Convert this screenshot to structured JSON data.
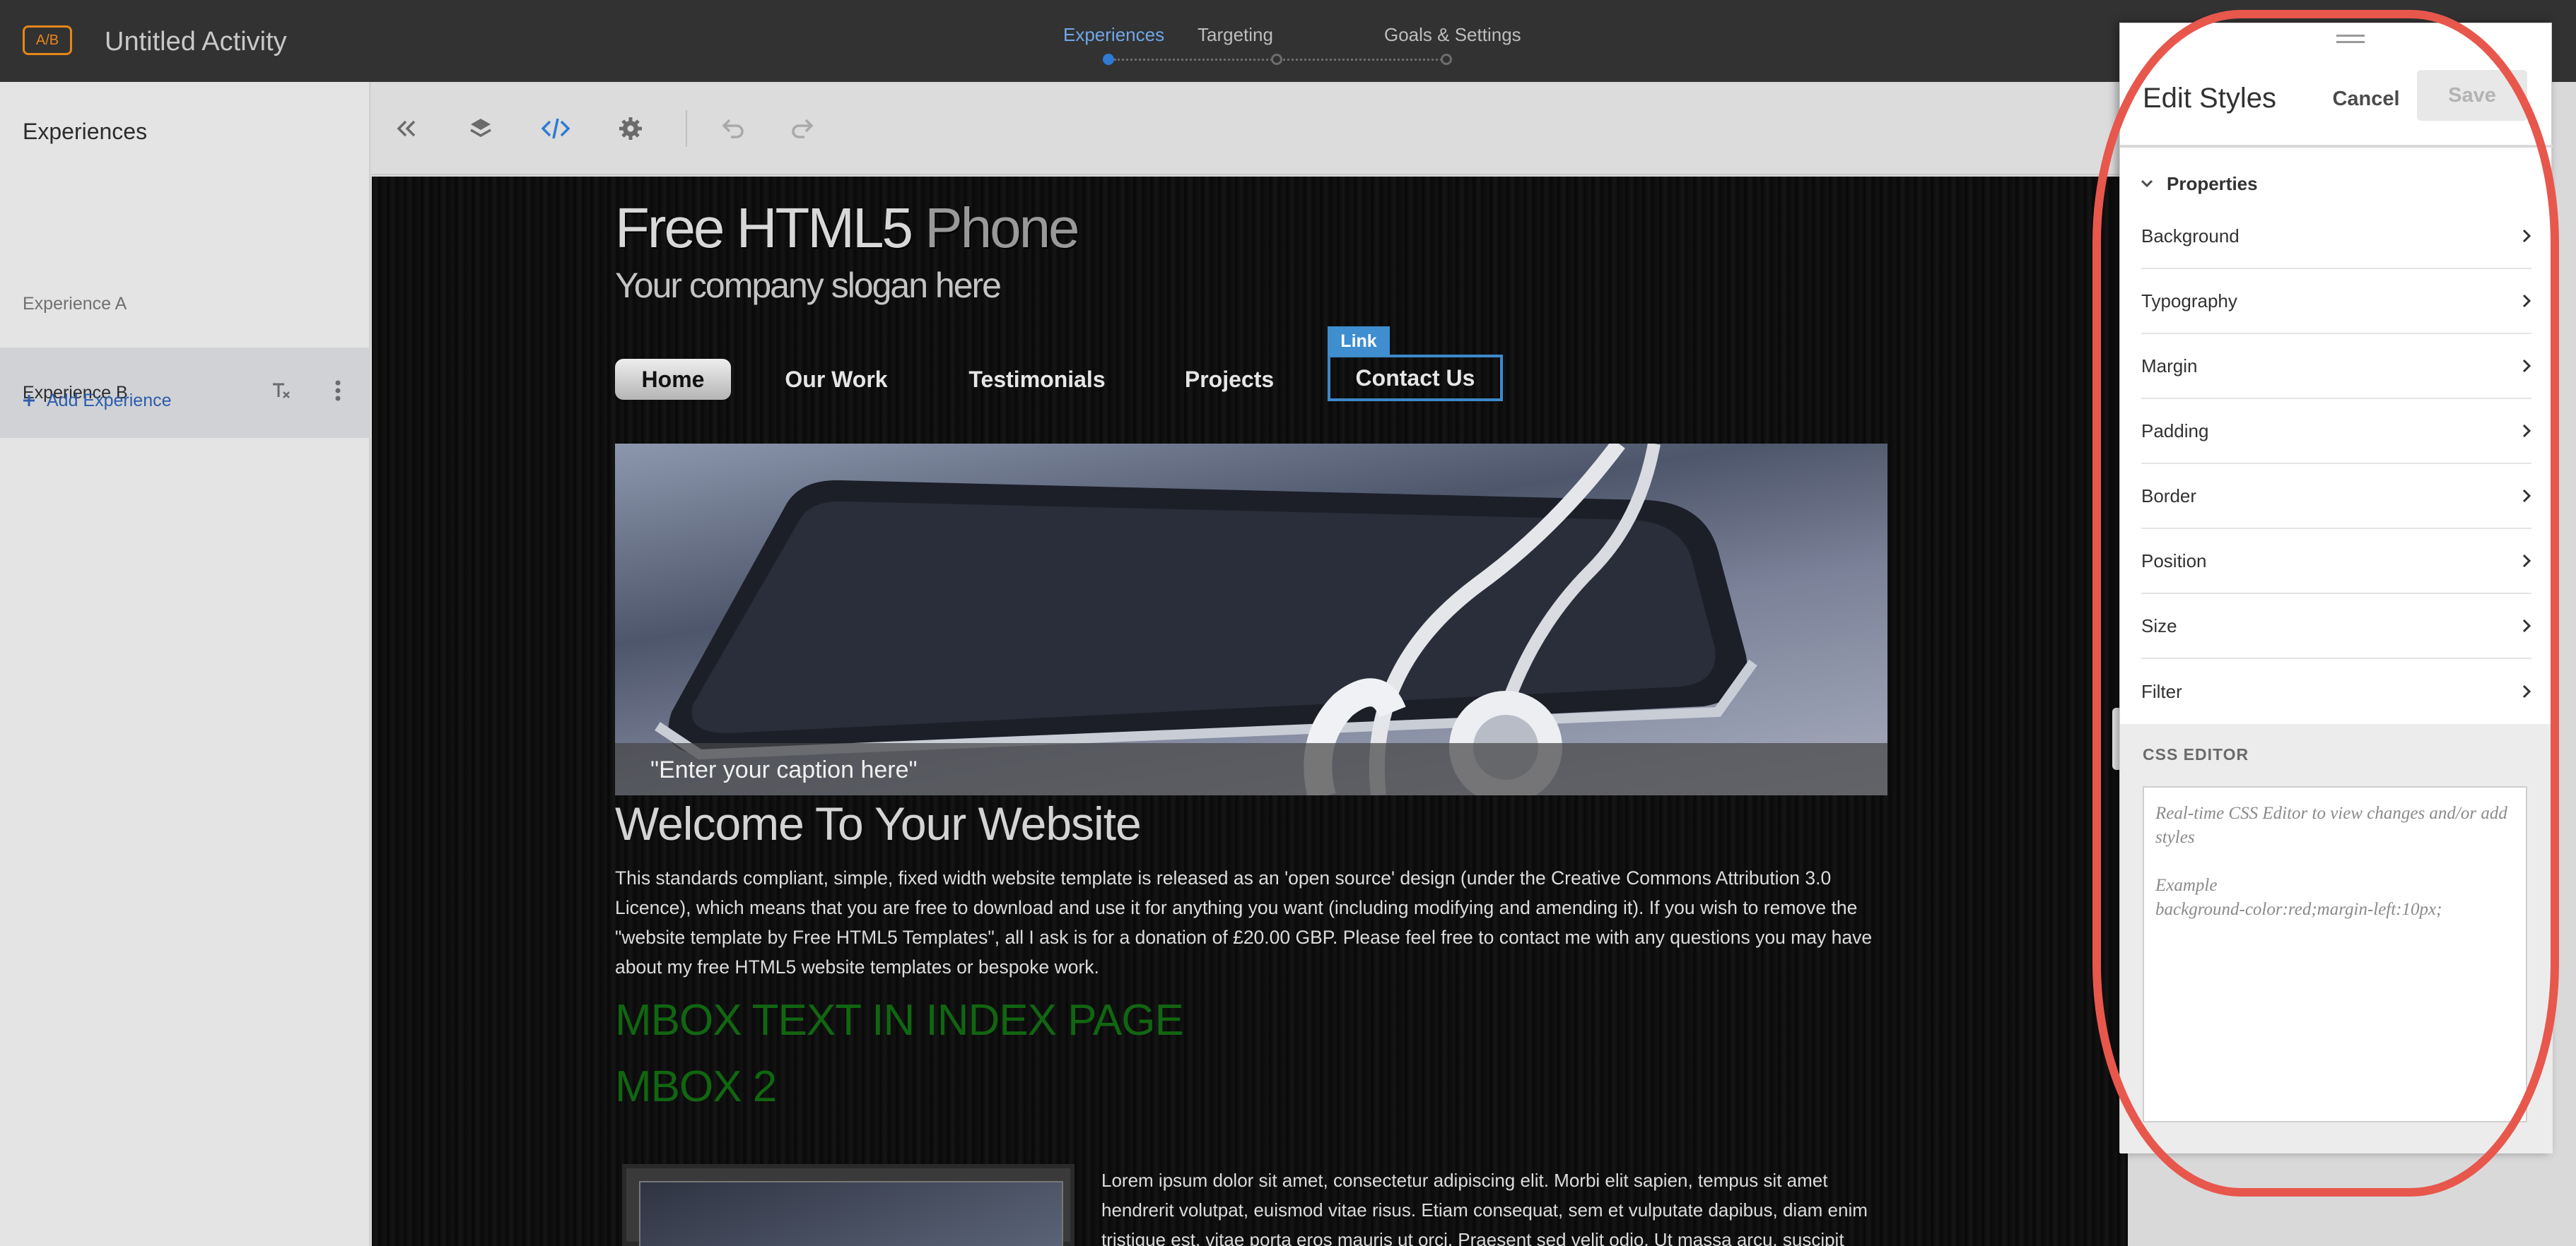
{
  "app": {
    "badge": "A/B",
    "activity_title": "Untitled Activity",
    "accent_color": "#2d7bd5",
    "highlight_color": "#e8574c"
  },
  "steps": [
    {
      "label": "Experiences",
      "active": true
    },
    {
      "label": "Targeting",
      "active": false
    },
    {
      "label": "Goals & Settings",
      "active": false
    }
  ],
  "left_panel": {
    "title": "Experiences",
    "experiences": [
      {
        "label": "Experience A",
        "selected": false
      },
      {
        "label": "Experience B",
        "selected": true
      }
    ],
    "add_label": "Add Experience"
  },
  "toolbar": {
    "icons": [
      "collapse-left-icon",
      "layers-icon",
      "code-icon",
      "gear-icon",
      "undo-icon",
      "redo-icon"
    ]
  },
  "site": {
    "title_main": "Free HTML5 ",
    "title_accent": "Phone",
    "slogan": "Your company slogan here",
    "nav": [
      "Home",
      "Our Work",
      "Testimonials",
      "Projects",
      "Contact Us"
    ],
    "selected_tag": "Link",
    "caption": "\"Enter your caption here\"",
    "welcome": "Welcome To Your Website",
    "body": "This standards compliant, simple, fixed width website template is released as an 'open source' design (under the Creative Commons Attribution 3.0 Licence), which means that you are free to download and use it for anything you want (including modifying and amending it). If you wish to remove the \"website template by Free HTML5 Templates\", all I ask is for a donation of £20.00 GBP. Please feel free to contact me with any questions you may have about my free HTML5 website templates or bespoke work.",
    "mbox1": "MBOX TEXT IN INDEX PAGE",
    "mbox2": "MBOX 2",
    "lorem": "Lorem ipsum dolor sit amet, consectetur adipiscing elit. Morbi elit sapien, tempus sit amet hendrerit volutpat, euismod vitae risus. Etiam consequat, sem et vulputate dapibus, diam enim tristique est, vitae porta eros mauris ut orci. Praesent sed velit odio. Ut massa arcu, suscipit"
  },
  "edit_panel": {
    "title": "Edit Styles",
    "cancel": "Cancel",
    "save": "Save",
    "section": "Properties",
    "properties": [
      "Background",
      "Typography",
      "Margin",
      "Padding",
      "Border",
      "Position",
      "Size",
      "Filter"
    ],
    "css_editor_label": "CSS EDITOR",
    "css_placeholder_1": "Real-time CSS Editor to view changes and/or add styles",
    "css_placeholder_2": "Example",
    "css_placeholder_3": "background-color:red;margin-left:10px;"
  }
}
